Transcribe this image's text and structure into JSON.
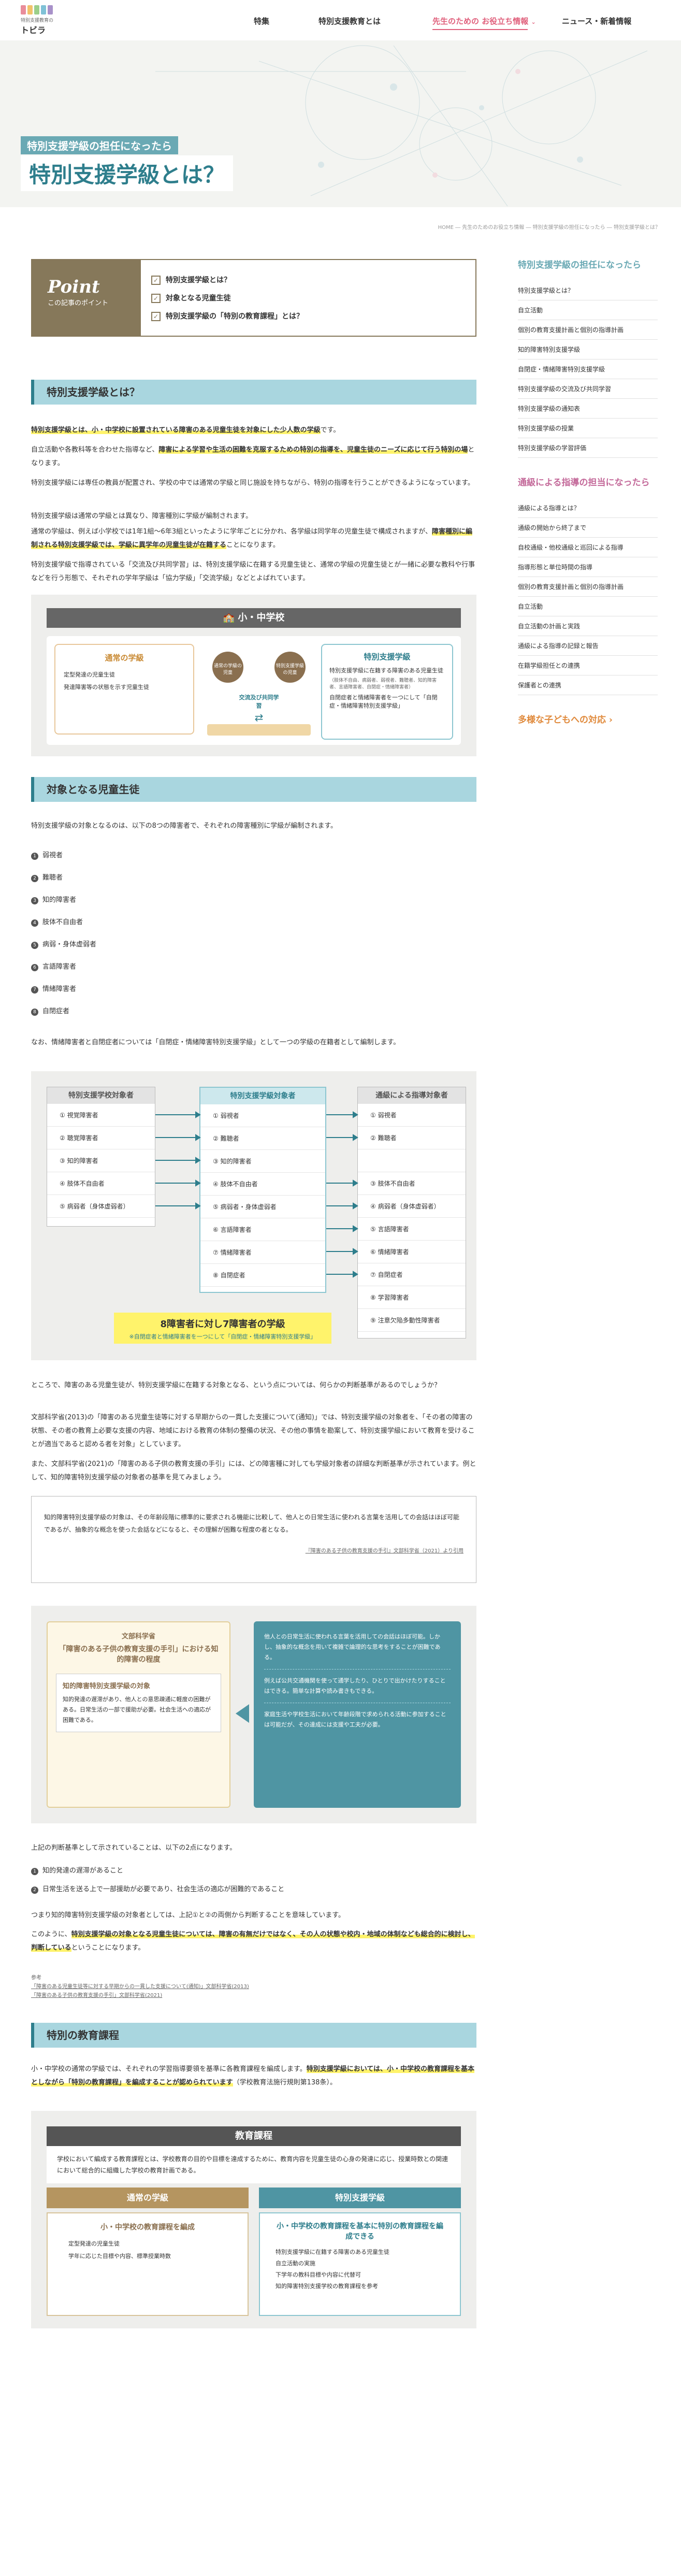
{
  "header": {
    "logo_sub": "特別支援教育の",
    "logo_main": "トビラ",
    "nav": [
      "特集",
      "特別支援教育とは",
      "先生のための お役立ち情報",
      "ニュース・新着情報"
    ]
  },
  "hero": {
    "tag": "特別支援学級の担任になったら",
    "title": "特別支援学級とは？"
  },
  "breadcrumb": "HOME ― 先生のためのお役立ち情報 ― 特別支援学級の担任になったら ― 特別支援学級とは？",
  "point": {
    "title": "Point",
    "sub": "この記事のポイント",
    "items": [
      "特別支援学級とは？",
      "対象となる児童生徒",
      "特別支援学級の「特別の教育課程」とは？"
    ]
  },
  "sec1": {
    "heading": "特別支援学級とは？",
    "p1a": "特別支援学級とは、小・中学校に設置されている障害のある児童生徒を対象にした少人数の学級",
    "p1b": "です。",
    "p2a": "自立活動や各教科等を合わせた指導など、",
    "p2b": "障害による学習や生活の困難を克服するための特別の指導を、児童生徒のニーズに応じて行う特別の場",
    "p2c": "となります。",
    "p3": "特別支援学級には専任の教員が配置され、学校の中では通常の学級と同じ施設を持ちながら、特別の指導を行うことができるようになっています。",
    "p4": "特別支援学級は通常の学級とは異なり、障害種別に学級が編制されます。",
    "p5a": "通常の学級は、例えば小学校では1年1組〜6年3組といったように学年ごとに分かれ、各学級は同学年の児童生徒で構成されますが、",
    "p5b": "障害種別に編制される特別支援学級では、学級に異学年の児童生徒が在籍する",
    "p5c": "ことになります。",
    "p6": "特別支援学級で指導されている「交流及び共同学習」は、特別支援学級に在籍する児童生徒と、通常の学級の児童生徒とが一緒に必要な教科や行事などを行う形態で、それぞれの学年学級は「協力学級」「交流学級」などとよばれています。"
  },
  "fig1": {
    "title": "小・中学校",
    "left_title": "通常の学級",
    "left_items": [
      "定型発達の児童生徒",
      "発達障害等の状態を示す児童生徒"
    ],
    "bubble_left": "通常の学級の児童",
    "bubble_right": "特別支援学級の児童",
    "arrow": "交流及び共同学習",
    "right_title": "特別支援学級",
    "right_items": [
      "特別支援学級に在籍する障害のある児童生徒",
      "自閉症者と情緒障害者を一つにして「自閉症・情緒障害特別支援学級」"
    ],
    "right_note": "（肢体不自由、病弱者、弱視者、難聴者、知的障害者、言語障害者、自閉症・情緒障害者）"
  },
  "sec2": {
    "heading": "対象となる児童生徒",
    "p1": "特別支援学級の対象となるのは、以下の8つの障害者で、それぞれの障害種別に学級が編制されます。",
    "list": [
      "弱視者",
      "難聴者",
      "知的障害者",
      "肢体不自由者",
      "病弱・身体虚弱者",
      "言語障害者",
      "情緒障害者",
      "自閉症者"
    ],
    "p2": "なお、情緒障害者と自閉症者については「自閉症・情緒障害特別支援学級」として一つの学級の在籍者として編制します。"
  },
  "fig2": {
    "col1_title": "特別支援学校対象者",
    "col1": [
      "視覚障害者",
      "聴覚障害者",
      "知的障害者",
      "肢体不自由者",
      "病弱者（身体虚弱者）"
    ],
    "col2_title": "特別支援学級対象者",
    "col2": [
      "弱視者",
      "難聴者",
      "知的障害者",
      "肢体不自由者",
      "病弱者・身体虚弱者",
      "言語障害者",
      "情緒障害者",
      "自閉症者"
    ],
    "col3_title": "通級による指導対象者",
    "col3": [
      "弱視者",
      "難聴者",
      "",
      "肢体不自由者",
      "病弱者（身体虚弱者）",
      "言語障害者",
      "情緒障害者",
      "自閉症者",
      "学習障害者",
      "注意欠陥多動性障害者"
    ],
    "caption": "8障害者に対し7障害者の学級",
    "caption_sub": "※自閉症者と情緒障害者を一つにして「自閉症・情緒障害特別支援学級」"
  },
  "sec3": {
    "p1": "ところで、障害のある児童生徒が、特別支援学級に在籍する対象となる、という点については、何らかの判断基準があるのでしょうか？",
    "p2": "文部科学省(2013)の「障害のある児童生徒等に対する早期からの一貫した支援について(通知)」では、特別支援学級の対象者を、「その者の障害の状態、その者の教育上必要な支援の内容、地域における教育の体制の整備の状況、その他の事情を勘案して、特別支援学級において教育を受けることが適当であると認める者を対象」としています。",
    "p3": "また、文部科学省(2021)の「障害のある子供の教育支援の手引」には、どの障害種に対しても学級対象者の詳細な判断基準が示されています。例として、知的障害特別支援学級の対象者の基準を見てみましょう。",
    "quote": "知的障害特別支援学級の対象は、その年齢段階に標準的に要求される機能に比較して、他人との日常生活に使われる言葉を活用しての会話はほぼ可能であるが、抽象的な概念を使った会話などになると、その理解が困難な程度の者となる。",
    "quote_src": "『障害のある子供の教育支援の手引』文部科学省（2021）より引用"
  },
  "fig3": {
    "title_sub": "文部科学省",
    "title": "「障害のある子供の教育支援の手引」における知的障害の程度",
    "box_title": "知的障害特別支援学級の対象",
    "box": "知的発達の遅滞があり、他人との意思疎通に軽度の困難がある。日常生活の一部で援助が必要。社会生活への適応が困難である。",
    "right": [
      "他人との日常生活に使われる言葉を活用しての会話はほぼ可能。しかし、抽象的な概念を用いて複雑で論理的な思考をすることが困難である。",
      "例えば公共交通機関を使って通学したり、ひとりで出かけたりすることはできる。簡単な計算や読み書きもできる。",
      "家庭生活や学校生活において年齢段階で求められる活動に参加することは可能だが、その達成には支援や工夫が必要。"
    ]
  },
  "sec4": {
    "p1": "上記の判断基準として示されていることは、以下の2点になります。",
    "list": [
      "知的発達の遅滞があること",
      "日常生活を送る上で一部援助が必要であり、社会生活の適応が困難的であること"
    ],
    "p2": "つまり知的障害特別支援学級の対象者としては、上記①と②の両側から判断することを意味しています。",
    "p3a": "このように、",
    "p3b": "特別支援学級の対象となる児童生徒については、障害の有無だけではなく、その人の状態や校内・地域の体制なども総合的に検討し、判断している",
    "p3c": "ということになります。",
    "ref_head": "参考",
    "refs": [
      "「障害のある児童生徒等に対する早期からの一貫した支援について(通知)」文部科学省(2013)",
      "「障害のある子供の教育支援の手引」文部科学省(2021)"
    ]
  },
  "sec5": {
    "heading": "特別の教育課程",
    "p1a": "小・中学校の通常の学級では、それぞれの学習指導要領を基準に各教育課程を編成します。",
    "p1b": "特別支援学級においては、小・中学校の教育課程を基本としながら「特別の教育課程」を編成することが認められています",
    "p1c": "（学校教育法施行規則第138条）。"
  },
  "fig4": {
    "title": "教育課程",
    "desc": "学校において編成する教育課程とは、学校教育の目的や目標を達成するために、教育内容を児童生徒の心身の発達に応じ、授業時数との関連において総合的に組織した学校の教育計画である。",
    "left_label": "通常の学級",
    "right_label": "特別支援学級",
    "left_title": "小・中学校の教育課程を編成",
    "left_items": [
      "定型発達の児童生徒",
      "学年に応じた目標や内容、標準授業時数"
    ],
    "right_title": "小・中学校の教育課程を基本に特別の教育課程を編成できる",
    "right_items": [
      "特別支援学級に在籍する障害のある児童生徒",
      "自立活動の実施",
      "下学年の教科目標や内容に代替可",
      "知的障害特別支援学校の教育課程を参考"
    ]
  },
  "sidebar": {
    "group1_title": "特別支援学級の担任になったら",
    "group1": [
      "特別支援学級とは？",
      "自立活動",
      "個別の教育支援計画と個別の指導計画",
      "知的障害特別支援学級",
      "自閉症・情緒障害特別支援学級",
      "特別支援学級の交流及び共同学習",
      "特別支援学級の通知表",
      "特別支援学級の授業",
      "特別支援学級の学習評価"
    ],
    "group2_title": "通級による指導の担当になったら",
    "group2": [
      "通級による指導とは？",
      "通級の開始から終了まで",
      "自校通級・他校通級と巡回による指導",
      "指導形態と単位時間の指導",
      "個別の教育支援計画と個別の指導計画",
      "自立活動",
      "自立活動の計画と実践",
      "通級による指導の記録と報告",
      "在籍学級担任との連携",
      "保護者との連携"
    ],
    "group3_title": "多様な子どもへの対応"
  },
  "colors": {
    "accent": "#2e7e8c",
    "light": "#a9d6df",
    "point": "#86785a",
    "nav_active": "#e0607c",
    "highlight": "#fff36b"
  }
}
